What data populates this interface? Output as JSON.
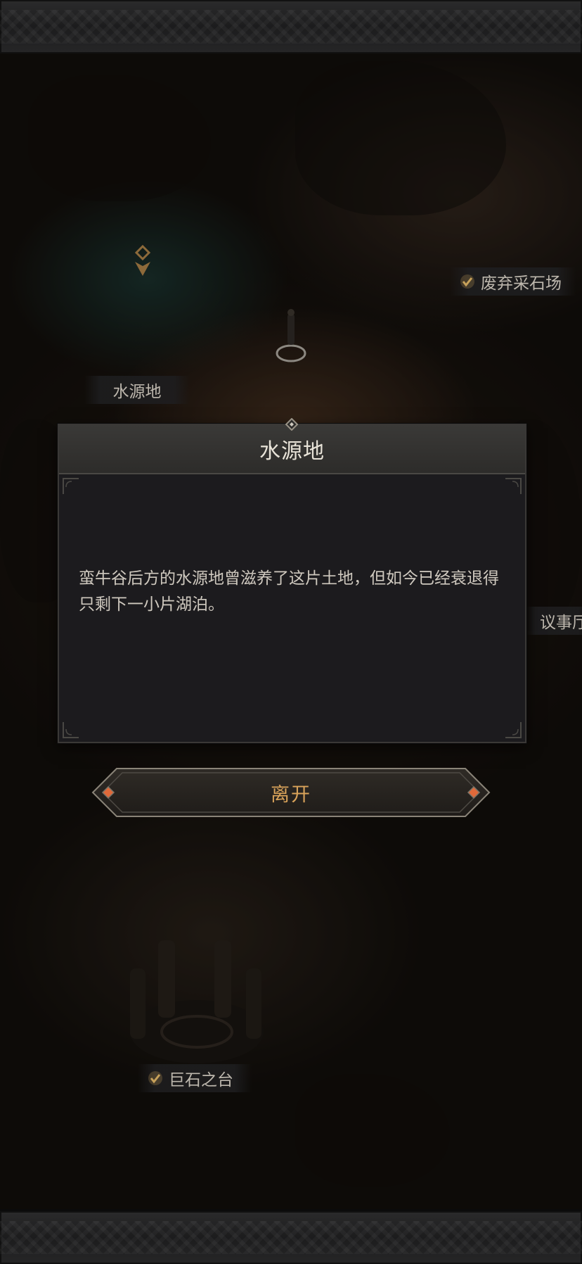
{
  "map": {
    "labels": {
      "quarry": "废弃采石场",
      "water_source": "水源地",
      "council": "议事厅",
      "megalith": "巨石之台"
    }
  },
  "dialog": {
    "title": "水源地",
    "description": "蛮牛谷后方的水源地曾滋养了这片土地，但如今已经衰退得只剩下一小片湖泊。"
  },
  "actions": {
    "leave_label": "离开"
  },
  "colors": {
    "accent_gold": "#d9a35a",
    "check_gold": "#c7a15a",
    "gem_orange": "#e0693a"
  }
}
